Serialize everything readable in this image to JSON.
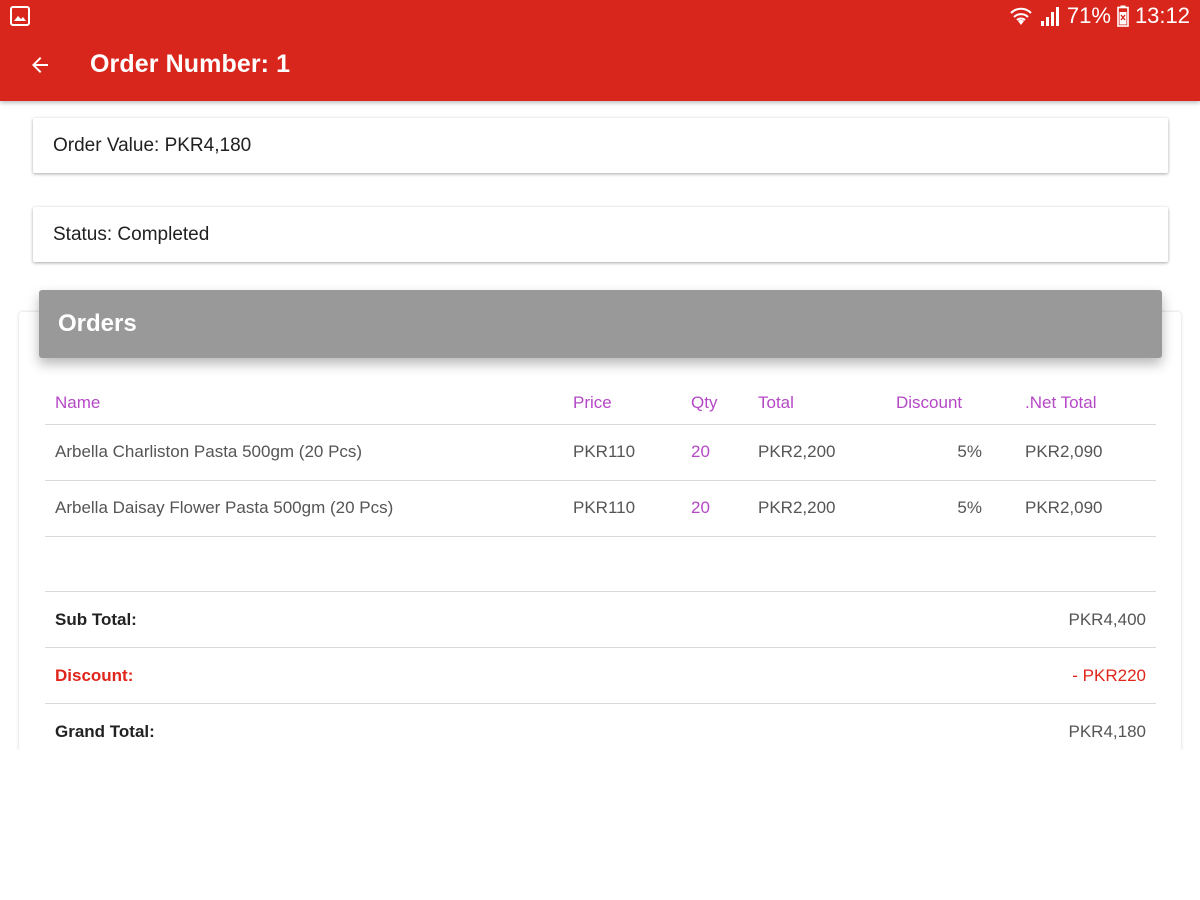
{
  "status_bar": {
    "battery_percent": "71%",
    "time": "13:12"
  },
  "app_bar": {
    "title": "Order Number: 1",
    "background": "#d9261c"
  },
  "cards": {
    "order_value": "Order Value: PKR4,180",
    "status": "Status: Completed"
  },
  "orders": {
    "header": "Orders",
    "columns": [
      "Name",
      "Price",
      "Qty",
      "Total",
      "Discount",
      ".Net Total"
    ],
    "rows": [
      {
        "name": "Arbella Charliston Pasta 500gm (20 Pcs)",
        "price": "PKR110",
        "qty": "20",
        "total": "PKR2,200",
        "discount": "5%",
        "net_total": "PKR2,090"
      },
      {
        "name": "Arbella Daisay Flower Pasta 500gm (20 Pcs)",
        "price": "PKR110",
        "qty": "20",
        "total": "PKR2,200",
        "discount": "5%",
        "net_total": "PKR2,090"
      }
    ]
  },
  "totals": {
    "sub_total_label": "Sub Total:",
    "sub_total_value": "PKR4,400",
    "discount_label": "Discount:",
    "discount_value": "- PKR220",
    "grand_total_label": "Grand Total:",
    "grand_total_value": "PKR4,180"
  },
  "colors": {
    "accent_purple": "#b548c6",
    "discount_red": "#e0251b",
    "header_gray": "#999999"
  },
  "icons": {
    "back": "arrow-back-icon",
    "status_left": "gallery-icon",
    "wifi": "wifi-icon",
    "signal": "signal-icon",
    "battery": "battery-icon"
  }
}
